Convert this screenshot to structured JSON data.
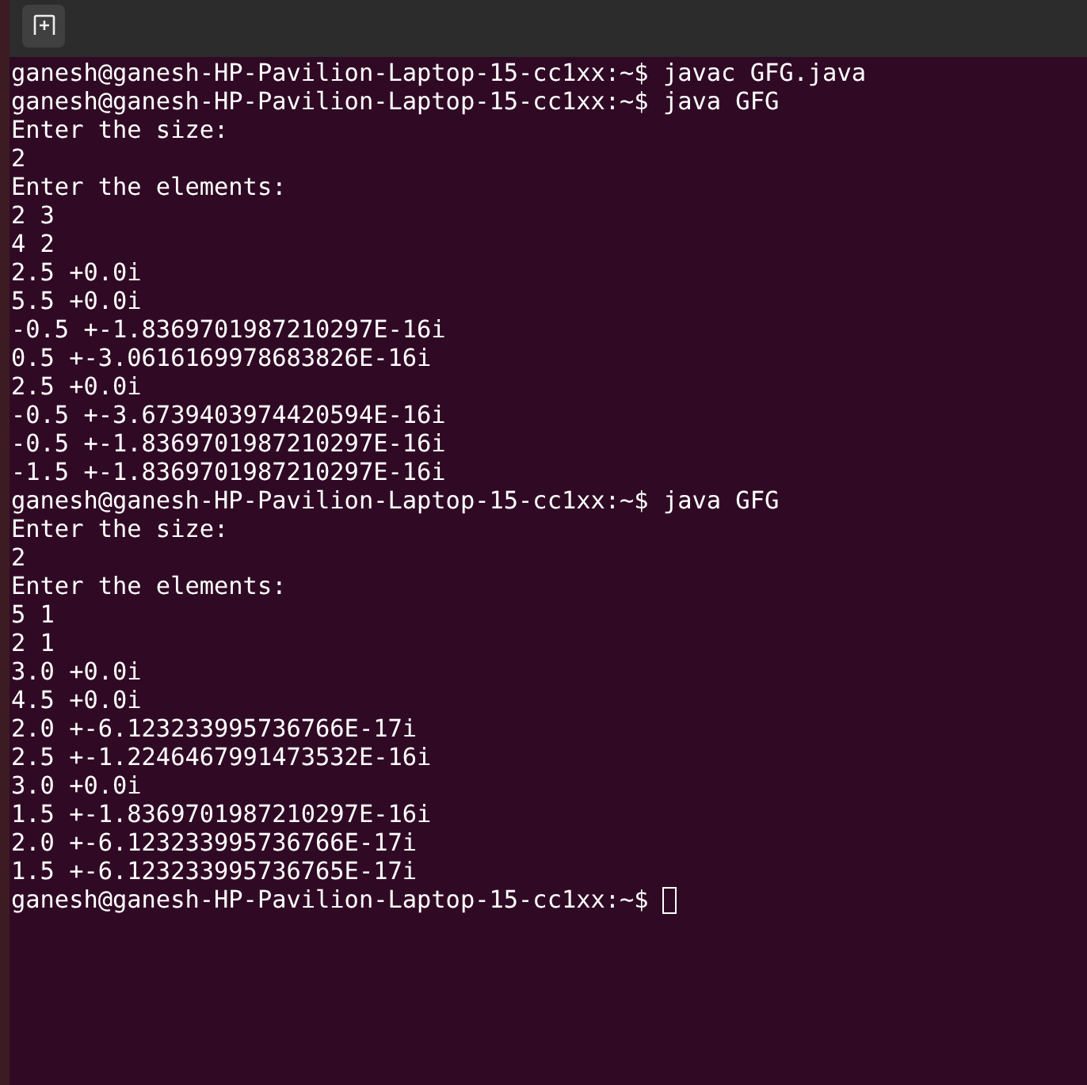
{
  "terminal": {
    "cursor_visible": true,
    "lines": [
      "ganesh@ganesh-HP-Pavilion-Laptop-15-cc1xx:~$ javac GFG.java",
      "ganesh@ganesh-HP-Pavilion-Laptop-15-cc1xx:~$ java GFG",
      "Enter the size:",
      "2",
      "Enter the elements:",
      "2 3",
      "4 2",
      "2.5 +0.0i",
      "5.5 +0.0i",
      "-0.5 +-1.8369701987210297E-16i",
      "0.5 +-3.0616169978683826E-16i",
      "2.5 +0.0i",
      "-0.5 +-3.6739403974420594E-16i",
      "-0.5 +-1.8369701987210297E-16i",
      "-1.5 +-1.8369701987210297E-16i",
      "ganesh@ganesh-HP-Pavilion-Laptop-15-cc1xx:~$ java GFG",
      "Enter the size:",
      "2",
      "Enter the elements:",
      "5 1",
      "2 1",
      "3.0 +0.0i",
      "4.5 +0.0i",
      "2.0 +-6.123233995736766E-17i",
      "2.5 +-1.2246467991473532E-16i",
      "3.0 +0.0i",
      "1.5 +-1.8369701987210297E-16i",
      "2.0 +-6.123233995736766E-17i",
      "1.5 +-6.123233995736765E-17i",
      "ganesh@ganesh-HP-Pavilion-Laptop-15-cc1xx:~$"
    ]
  }
}
